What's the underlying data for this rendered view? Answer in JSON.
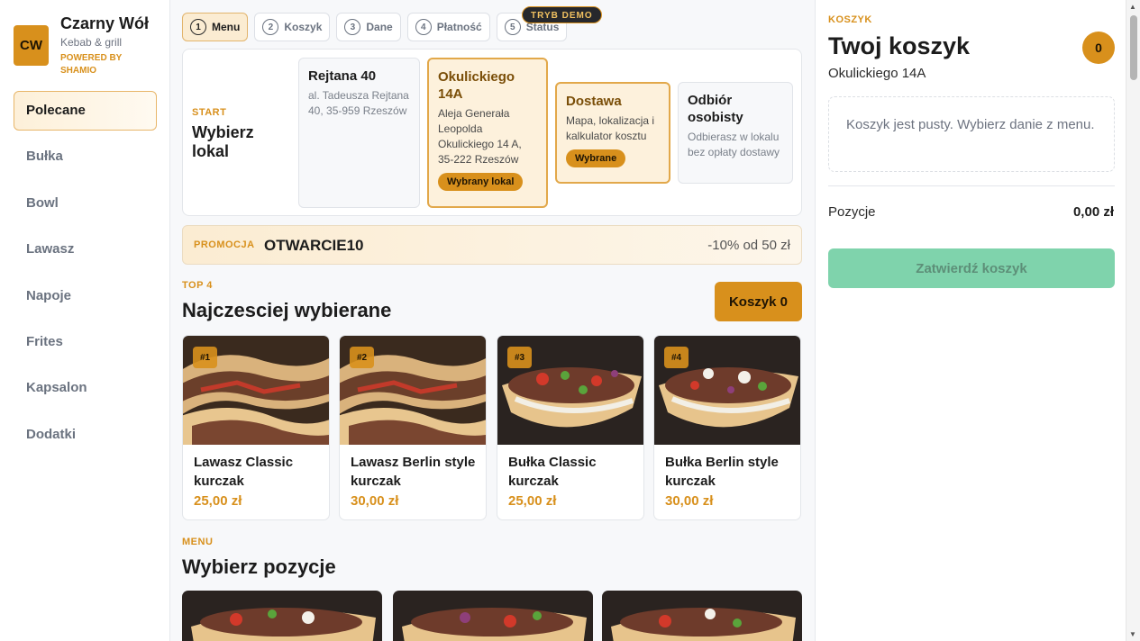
{
  "brand": {
    "logo": "CW",
    "name": "Czarny Wół",
    "subtitle": "Kebab & grill",
    "powered": "POWERED BY SHAMIO"
  },
  "nav": {
    "items": [
      {
        "label": "Polecane"
      },
      {
        "label": "Bułka"
      },
      {
        "label": "Bowl"
      },
      {
        "label": "Lawasz"
      },
      {
        "label": "Napoje"
      },
      {
        "label": "Frites"
      },
      {
        "label": "Kapsalon"
      },
      {
        "label": "Dodatki"
      }
    ]
  },
  "steps": [
    {
      "num": "1",
      "label": "Menu"
    },
    {
      "num": "2",
      "label": "Koszyk"
    },
    {
      "num": "3",
      "label": "Dane"
    },
    {
      "num": "4",
      "label": "Płatność"
    },
    {
      "num": "5",
      "label": "Status"
    }
  ],
  "demo_badge": "TRYB DEMO",
  "locals": {
    "kicker": "START",
    "title": "Wybierz lokal",
    "cards": [
      {
        "title": "Rejtana 40",
        "desc": "al. Tadeusza Rejtana 40, 35-959 Rzeszów"
      },
      {
        "title": "Okulickiego 14A",
        "desc": "Aleja Generała Leopolda Okulickiego 14 A, 35-222 Rzeszów",
        "badge": "Wybrany lokal"
      },
      {
        "title": "Dostawa",
        "desc": "Mapa, lokalizacja i kalkulator kosztu",
        "badge": "Wybrane"
      },
      {
        "title": "Odbiór osobisty",
        "desc": "Odbierasz w lokalu bez opłaty dostawy"
      }
    ]
  },
  "promo": {
    "label": "PROMOCJA",
    "code": "OTWARCIE10",
    "note": "-10% od 50 zł"
  },
  "top": {
    "kicker": "TOP 4",
    "title": "Najczesciej wybierane",
    "cart_button": "Koszyk 0",
    "items": [
      {
        "rank": "#1",
        "name": "Lawasz Classic kurczak",
        "price": "25,00 zł"
      },
      {
        "rank": "#2",
        "name": "Lawasz Berlin style kurczak",
        "price": "30,00 zł"
      },
      {
        "rank": "#3",
        "name": "Bułka Classic kurczak",
        "price": "25,00 zł"
      },
      {
        "rank": "#4",
        "name": "Bułka Berlin style kurczak",
        "price": "30,00 zł"
      }
    ]
  },
  "menu": {
    "kicker": "MENU",
    "title": "Wybierz pozycje"
  },
  "cart": {
    "kicker": "KOSZYK",
    "title": "Twoj koszyk",
    "count": "0",
    "location": "Okulickiego 14A",
    "empty": "Koszyk jest pusty. Wybierz danie z menu.",
    "positions_label": "Pozycje",
    "positions_value": "0,00 zł",
    "confirm": "Zatwierdź koszyk"
  },
  "colors": {
    "accent": "#d8901c",
    "confirm": "#7fd3ac"
  }
}
